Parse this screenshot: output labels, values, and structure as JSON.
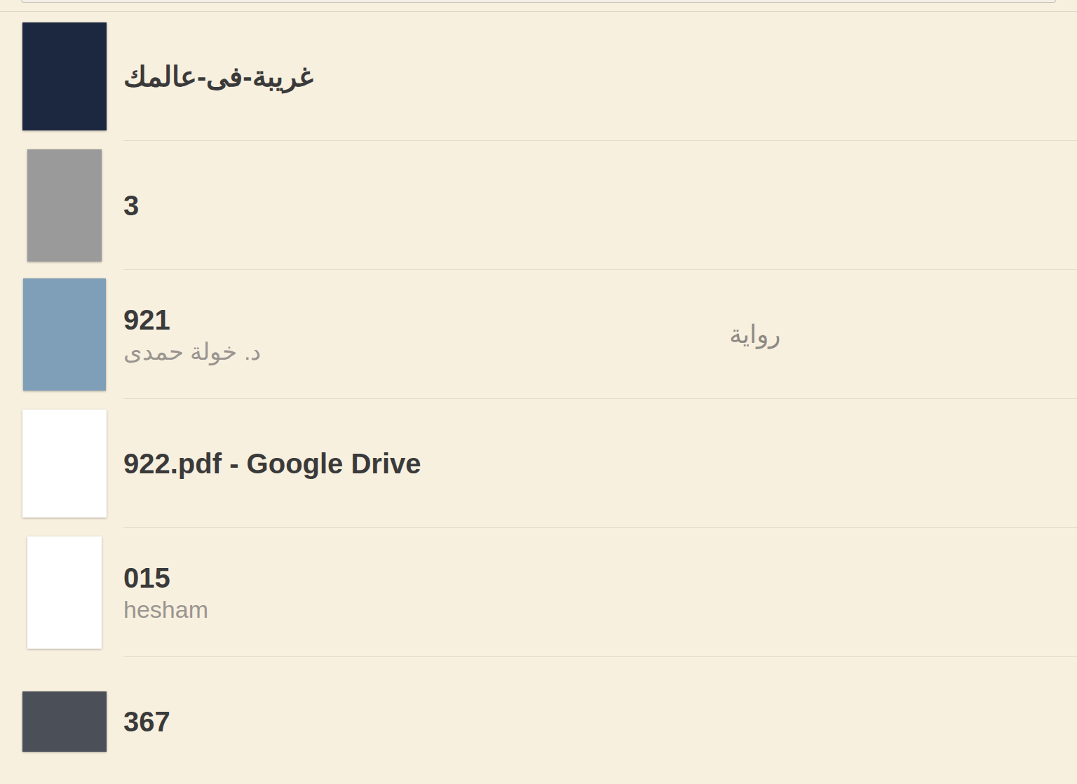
{
  "books": [
    {
      "title": "غريبة-فى-عالمك",
      "author": "",
      "category": "",
      "color": "#1c2740"
    },
    {
      "title": "3",
      "author": "",
      "category": "",
      "color": "#9a9a9a"
    },
    {
      "title": "921",
      "author": "د. خولة حمدى",
      "category": "رواية",
      "color": "#7f9fb8"
    },
    {
      "title": "922.pdf - Google Drive",
      "author": "",
      "category": "",
      "color": "#ffffff"
    },
    {
      "title": "015",
      "author": "hesham",
      "category": "",
      "color": "#ffffff"
    },
    {
      "title": "367",
      "author": "",
      "category": "",
      "color": "#4a4f58"
    }
  ]
}
